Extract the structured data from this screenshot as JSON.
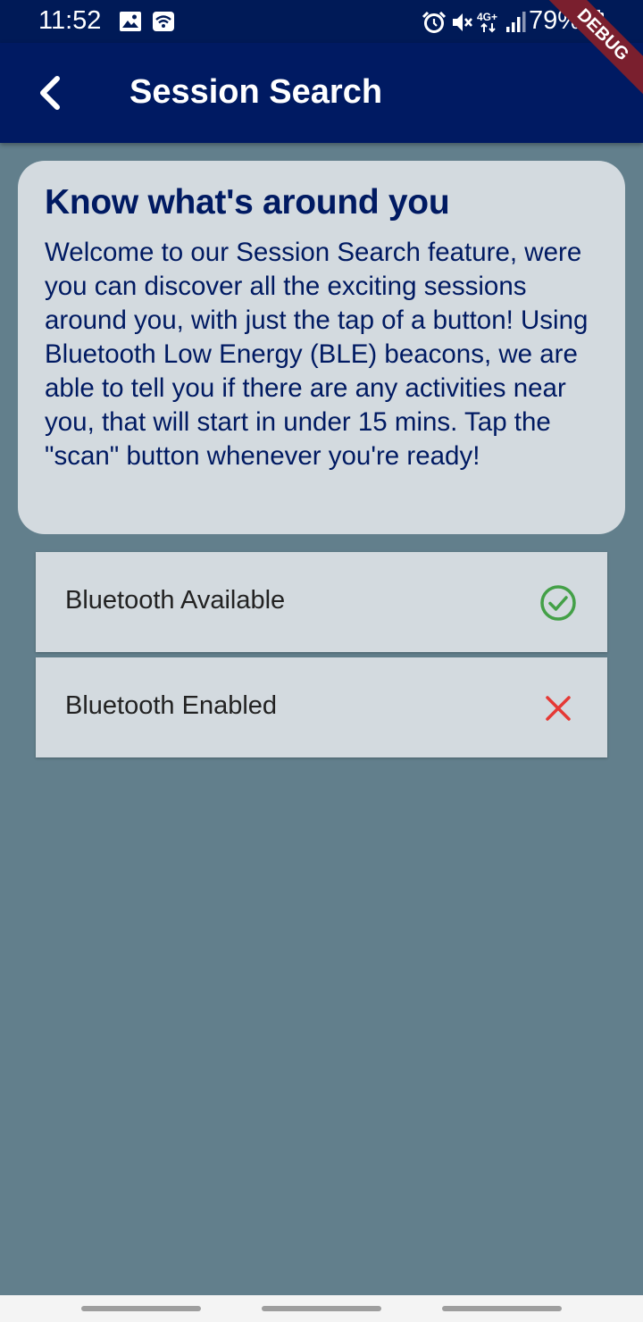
{
  "status_bar": {
    "time": "11:52",
    "battery_percent": "79%",
    "network": "4G+",
    "icons": [
      "image-icon",
      "wifi-calling-icon",
      "alarm-icon",
      "mute-icon",
      "network-icon",
      "signal-icon",
      "battery-icon"
    ]
  },
  "debug_banner": "DEBUG",
  "app_bar": {
    "title": "Session Search",
    "back_icon": "chevron-left-icon",
    "background": "#001a62"
  },
  "info_card": {
    "title": "Know what's around you",
    "body": "Welcome to our Session Search feature, were you can discover all the exciting sessions around you, with just the tap of a button! Using Bluetooth Low Energy (BLE) beacons, we are able to tell you if there are any activities near you, that will start in under 15 mins. Tap the \"scan\" button whenever you're ready!"
  },
  "checks": [
    {
      "label": "Bluetooth Available",
      "status": "ok",
      "icon": "check-circle-icon",
      "color": "#43a047"
    },
    {
      "label": "Bluetooth Enabled",
      "status": "fail",
      "icon": "close-icon",
      "color": "#e53935"
    }
  ],
  "colors": {
    "page_background": "#627f8c",
    "card_background": "#d3dadf",
    "accent": "#001a62"
  }
}
